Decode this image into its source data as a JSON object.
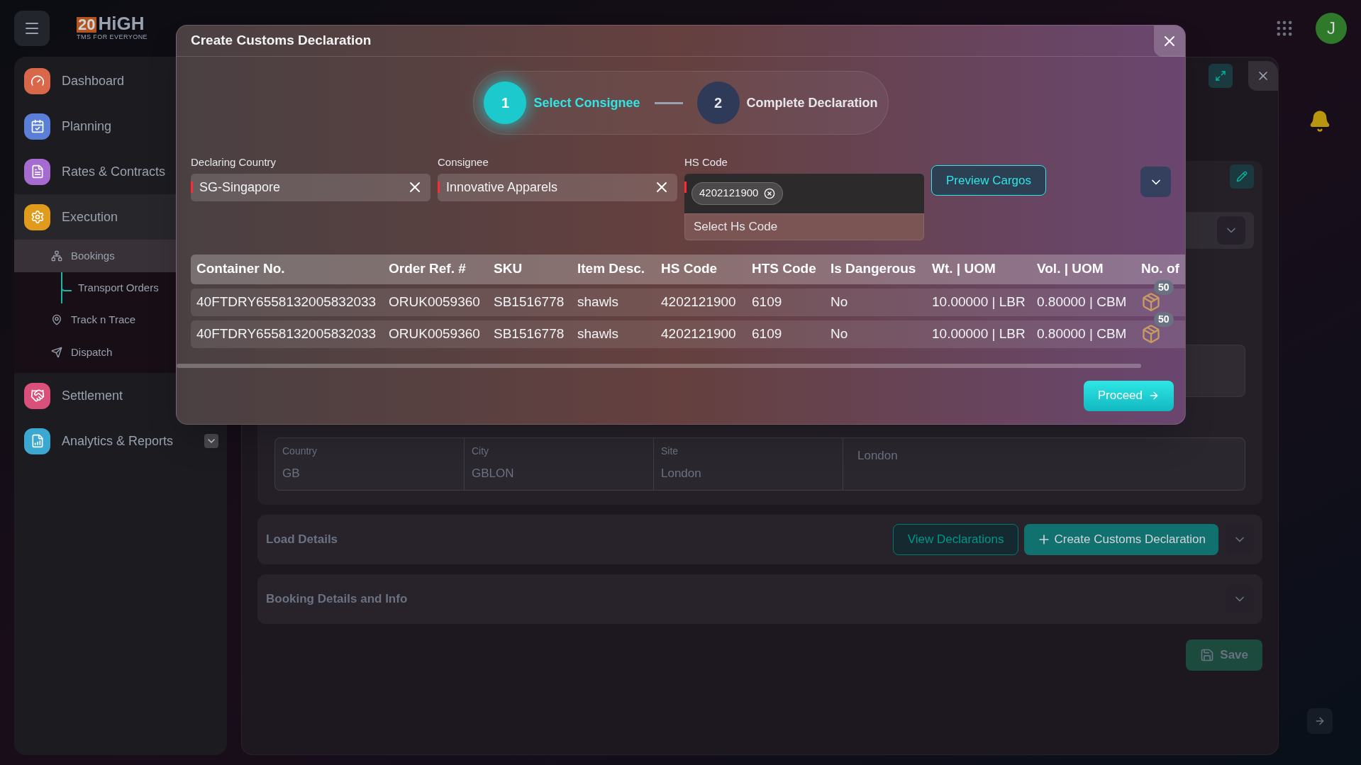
{
  "header": {
    "logo": {
      "number": "20",
      "name": "HiGH",
      "tagline": "TMS FOR EVERYONE"
    },
    "avatar": "J"
  },
  "sidebar": {
    "items": [
      {
        "label": "Dashboard",
        "color": "#d9674a",
        "kind": "link"
      },
      {
        "label": "Planning",
        "color": "#5b7fd6",
        "kind": "link"
      },
      {
        "label": "Rates & Contracts",
        "color": "#a66bd0",
        "kind": "link"
      },
      {
        "label": "Execution",
        "color": "#e09a1c",
        "kind": "group",
        "expanded": true,
        "children": [
          {
            "label": "Bookings",
            "selected": true,
            "children": [
              {
                "label": "Transport Orders",
                "selected": false
              }
            ]
          },
          {
            "label": "Track n Trace",
            "selected": false
          },
          {
            "label": "Dispatch",
            "selected": false
          }
        ]
      },
      {
        "label": "Settlement",
        "color": "#d9507a",
        "kind": "link"
      },
      {
        "label": "Analytics & Reports",
        "color": "#3aa8d0",
        "kind": "group",
        "expanded": false
      }
    ]
  },
  "main": {
    "discharge": {
      "fields": [
        {
          "label": "Country",
          "value": "GB"
        },
        {
          "label": "City",
          "value": "GBLON"
        },
        {
          "label": "Site",
          "value": "London"
        }
      ],
      "address": "London"
    },
    "load_details": {
      "title": "Load Details",
      "buttons": [
        "View Declarations",
        "Create Customs Declaration"
      ]
    },
    "booking_details": {
      "title": "Booking Details and Info"
    },
    "save_button": "Save"
  },
  "modal": {
    "title": "Create Customs Declaration",
    "steps": [
      {
        "number": "1",
        "label": "Select Consignee",
        "selected": true
      },
      {
        "number": "2",
        "label": "Complete Declaration",
        "selected": false
      }
    ],
    "fields": [
      {
        "label": "Declaring Country",
        "kind": "select",
        "value": "SG-Singapore",
        "required": true
      },
      {
        "label": "Consignee",
        "kind": "select",
        "value": "Innovative Apparels",
        "required": true
      },
      {
        "label": "HS Code",
        "kind": "multi",
        "tags": [
          "4202121900"
        ],
        "option": "Select Hs Code",
        "required": true
      }
    ],
    "preview_button": "Preview Cargos",
    "table": {
      "columns": [
        "Container No.",
        "Order Ref. #",
        "SKU",
        "Item Desc.",
        "HS Code",
        "HTS Code",
        "Is Dangerous",
        "Wt. | UOM",
        "Vol. | UOM",
        "No. of"
      ],
      "rows": [
        {
          "cells": [
            "40FTDRY6558132005832033",
            "ORUK0059360",
            "SB1516778",
            "shawls",
            "4202121900",
            "6109",
            "No",
            "10.00000 | LBR",
            "0.80000 | CBM"
          ],
          "count": "50"
        },
        {
          "cells": [
            "40FTDRY6558132005832033",
            "ORUK0059360",
            "SB1516778",
            "shawls",
            "4202121900",
            "6109",
            "No",
            "10.00000 | LBR",
            "0.80000 | CBM"
          ],
          "count": "50"
        }
      ]
    },
    "proceed_button": "Proceed"
  }
}
